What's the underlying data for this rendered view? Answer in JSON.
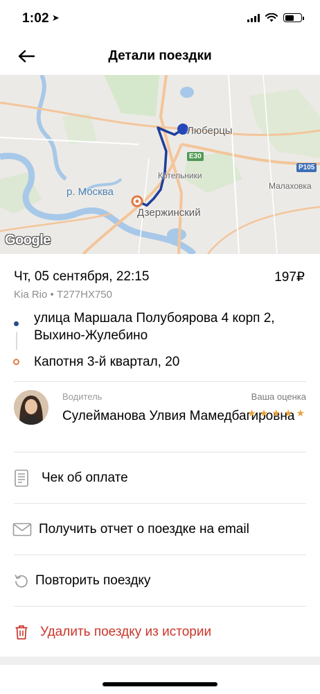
{
  "status_bar": {
    "time": "1:02",
    "location_glyph": "➤"
  },
  "header": {
    "title": "Детали поездки"
  },
  "map": {
    "labels": {
      "lyubertsy": "Люберцы",
      "kotelniki": "Котельники",
      "moskva_river": "р. Москва",
      "dzerzhinsky": "Дзержинский",
      "malakhovka": "Малаховка"
    },
    "badges": {
      "e30": "E30",
      "r105": "P105"
    },
    "logo": "Google",
    "colors": {
      "route": "#1e3e9a",
      "origin": "#2547b8",
      "destination": "#e07a45",
      "water": "#a7c8e8",
      "road": "#f3c59a"
    }
  },
  "trip": {
    "datetime": "Чт, 05 сентября, 22:15",
    "price": "197₽",
    "car": "Kia Rio • Т277НХ750",
    "from": "улица Маршала Полубоярова 4 корп 2, Выхино-Жулебино",
    "to": "Капотня 3-й квартал, 20"
  },
  "driver": {
    "caption": "Водитель",
    "name": "Сулейманова Улвия Мамедбагировна",
    "rating_caption": "Ваша оценка",
    "rating": 5,
    "stars": [
      "★",
      "★",
      "★",
      "★",
      "★"
    ]
  },
  "actions": {
    "receipt": "Чек об оплате",
    "email_report": "Получить отчет о поездке на email",
    "repeat": "Повторить поездку",
    "delete": "Удалить поездку из истории"
  },
  "colors": {
    "accent_danger": "#c9362b",
    "star": "#e9a23b",
    "secondary_text": "#8e8e8e"
  }
}
